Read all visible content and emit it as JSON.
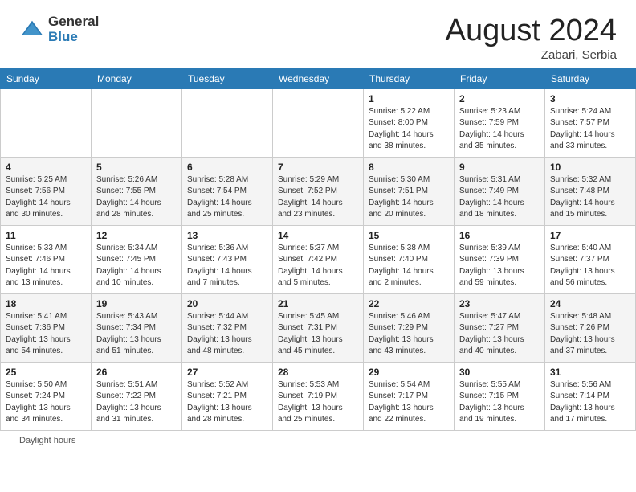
{
  "header": {
    "logo_general": "General",
    "logo_blue": "Blue",
    "month_year": "August 2024",
    "location": "Zabari, Serbia"
  },
  "days_of_week": [
    "Sunday",
    "Monday",
    "Tuesday",
    "Wednesday",
    "Thursday",
    "Friday",
    "Saturday"
  ],
  "weeks": [
    [
      {
        "day": "",
        "info": ""
      },
      {
        "day": "",
        "info": ""
      },
      {
        "day": "",
        "info": ""
      },
      {
        "day": "",
        "info": ""
      },
      {
        "day": "1",
        "info": "Sunrise: 5:22 AM\nSunset: 8:00 PM\nDaylight: 14 hours\nand 38 minutes."
      },
      {
        "day": "2",
        "info": "Sunrise: 5:23 AM\nSunset: 7:59 PM\nDaylight: 14 hours\nand 35 minutes."
      },
      {
        "day": "3",
        "info": "Sunrise: 5:24 AM\nSunset: 7:57 PM\nDaylight: 14 hours\nand 33 minutes."
      }
    ],
    [
      {
        "day": "4",
        "info": "Sunrise: 5:25 AM\nSunset: 7:56 PM\nDaylight: 14 hours\nand 30 minutes."
      },
      {
        "day": "5",
        "info": "Sunrise: 5:26 AM\nSunset: 7:55 PM\nDaylight: 14 hours\nand 28 minutes."
      },
      {
        "day": "6",
        "info": "Sunrise: 5:28 AM\nSunset: 7:54 PM\nDaylight: 14 hours\nand 25 minutes."
      },
      {
        "day": "7",
        "info": "Sunrise: 5:29 AM\nSunset: 7:52 PM\nDaylight: 14 hours\nand 23 minutes."
      },
      {
        "day": "8",
        "info": "Sunrise: 5:30 AM\nSunset: 7:51 PM\nDaylight: 14 hours\nand 20 minutes."
      },
      {
        "day": "9",
        "info": "Sunrise: 5:31 AM\nSunset: 7:49 PM\nDaylight: 14 hours\nand 18 minutes."
      },
      {
        "day": "10",
        "info": "Sunrise: 5:32 AM\nSunset: 7:48 PM\nDaylight: 14 hours\nand 15 minutes."
      }
    ],
    [
      {
        "day": "11",
        "info": "Sunrise: 5:33 AM\nSunset: 7:46 PM\nDaylight: 14 hours\nand 13 minutes."
      },
      {
        "day": "12",
        "info": "Sunrise: 5:34 AM\nSunset: 7:45 PM\nDaylight: 14 hours\nand 10 minutes."
      },
      {
        "day": "13",
        "info": "Sunrise: 5:36 AM\nSunset: 7:43 PM\nDaylight: 14 hours\nand 7 minutes."
      },
      {
        "day": "14",
        "info": "Sunrise: 5:37 AM\nSunset: 7:42 PM\nDaylight: 14 hours\nand 5 minutes."
      },
      {
        "day": "15",
        "info": "Sunrise: 5:38 AM\nSunset: 7:40 PM\nDaylight: 14 hours\nand 2 minutes."
      },
      {
        "day": "16",
        "info": "Sunrise: 5:39 AM\nSunset: 7:39 PM\nDaylight: 13 hours\nand 59 minutes."
      },
      {
        "day": "17",
        "info": "Sunrise: 5:40 AM\nSunset: 7:37 PM\nDaylight: 13 hours\nand 56 minutes."
      }
    ],
    [
      {
        "day": "18",
        "info": "Sunrise: 5:41 AM\nSunset: 7:36 PM\nDaylight: 13 hours\nand 54 minutes."
      },
      {
        "day": "19",
        "info": "Sunrise: 5:43 AM\nSunset: 7:34 PM\nDaylight: 13 hours\nand 51 minutes."
      },
      {
        "day": "20",
        "info": "Sunrise: 5:44 AM\nSunset: 7:32 PM\nDaylight: 13 hours\nand 48 minutes."
      },
      {
        "day": "21",
        "info": "Sunrise: 5:45 AM\nSunset: 7:31 PM\nDaylight: 13 hours\nand 45 minutes."
      },
      {
        "day": "22",
        "info": "Sunrise: 5:46 AM\nSunset: 7:29 PM\nDaylight: 13 hours\nand 43 minutes."
      },
      {
        "day": "23",
        "info": "Sunrise: 5:47 AM\nSunset: 7:27 PM\nDaylight: 13 hours\nand 40 minutes."
      },
      {
        "day": "24",
        "info": "Sunrise: 5:48 AM\nSunset: 7:26 PM\nDaylight: 13 hours\nand 37 minutes."
      }
    ],
    [
      {
        "day": "25",
        "info": "Sunrise: 5:50 AM\nSunset: 7:24 PM\nDaylight: 13 hours\nand 34 minutes."
      },
      {
        "day": "26",
        "info": "Sunrise: 5:51 AM\nSunset: 7:22 PM\nDaylight: 13 hours\nand 31 minutes."
      },
      {
        "day": "27",
        "info": "Sunrise: 5:52 AM\nSunset: 7:21 PM\nDaylight: 13 hours\nand 28 minutes."
      },
      {
        "day": "28",
        "info": "Sunrise: 5:53 AM\nSunset: 7:19 PM\nDaylight: 13 hours\nand 25 minutes."
      },
      {
        "day": "29",
        "info": "Sunrise: 5:54 AM\nSunset: 7:17 PM\nDaylight: 13 hours\nand 22 minutes."
      },
      {
        "day": "30",
        "info": "Sunrise: 5:55 AM\nSunset: 7:15 PM\nDaylight: 13 hours\nand 19 minutes."
      },
      {
        "day": "31",
        "info": "Sunrise: 5:56 AM\nSunset: 7:14 PM\nDaylight: 13 hours\nand 17 minutes."
      }
    ]
  ],
  "footer": {
    "daylight_hours": "Daylight hours"
  }
}
